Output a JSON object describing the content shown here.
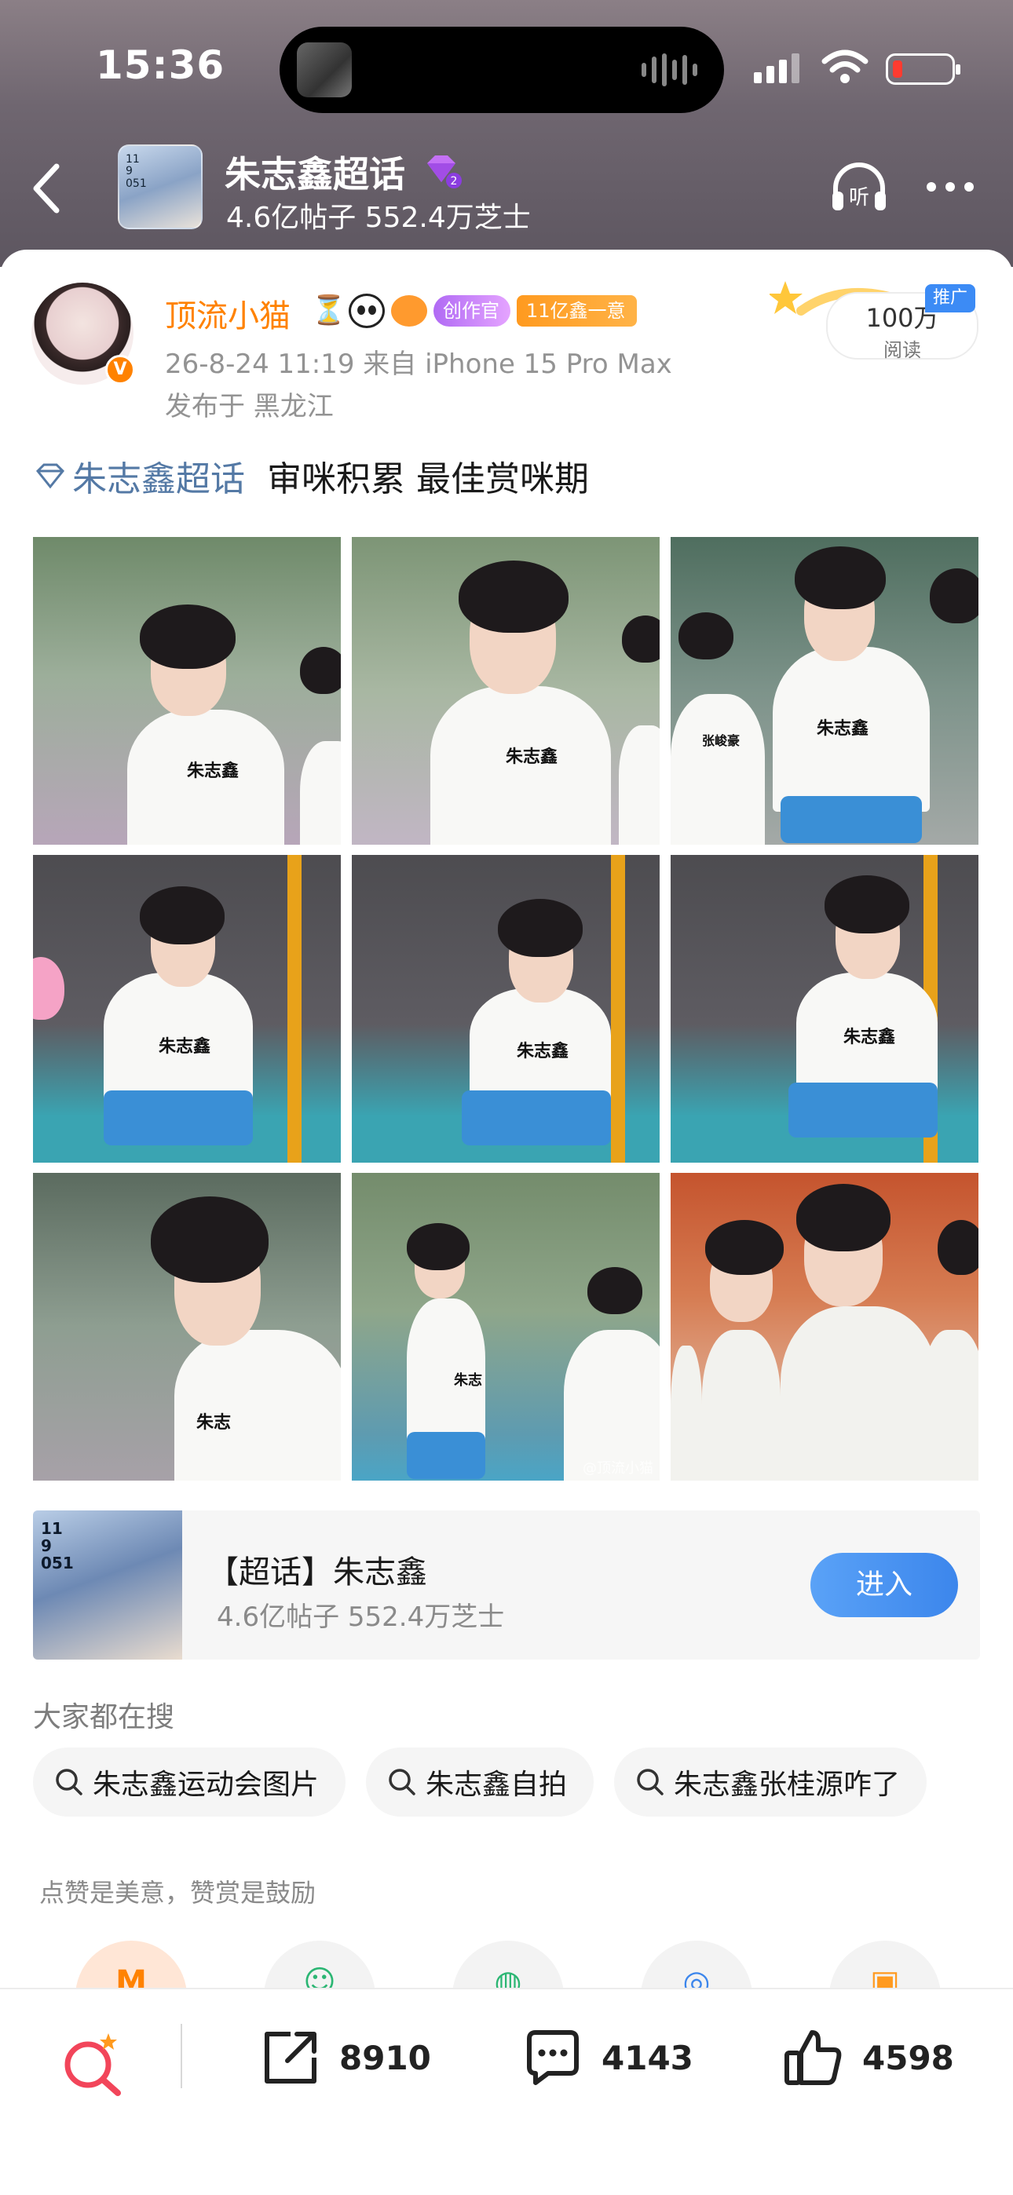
{
  "status_bar": {
    "time": "15:36"
  },
  "header": {
    "topic_title": "朱志鑫超话",
    "topic_stats": "4.6亿帖子 552.4万芝士",
    "avatar_text": "11\n9\n051",
    "gem_level": "2"
  },
  "post": {
    "author": "顶流小猫",
    "badge_creator": "创作官",
    "badge_fans": "11亿鑫一意",
    "meta": "26-8-24 11:19   来自 iPhone 15 Pro Max",
    "location": "发布于 黑龙江",
    "reads_num": "100万",
    "reads_label": "阅读",
    "promo_tag": "推广",
    "topic_link": "朱志鑫超话",
    "text": "审咪积累 最佳赏咪期",
    "watermark": "@顶流小猫"
  },
  "topic_card": {
    "title": "【超话】朱志鑫",
    "stats": "4.6亿帖子 552.4万芝士",
    "enter_label": "进入",
    "img_text": "11\n9\n051"
  },
  "trending": {
    "title": "大家都在搜",
    "chips": [
      "朱志鑫运动会图片",
      "朱志鑫自拍",
      "朱志鑫张桂源咋了"
    ]
  },
  "reward": {
    "title": "点赞是美意，赞赏是鼓励"
  },
  "bottom_bar": {
    "share_count": "8910",
    "comment_count": "4143",
    "like_count": "4598"
  },
  "colors": {
    "accent_orange": "#ff8200",
    "topic_blue": "#5479a5",
    "button_blue": "#3c86ec"
  }
}
